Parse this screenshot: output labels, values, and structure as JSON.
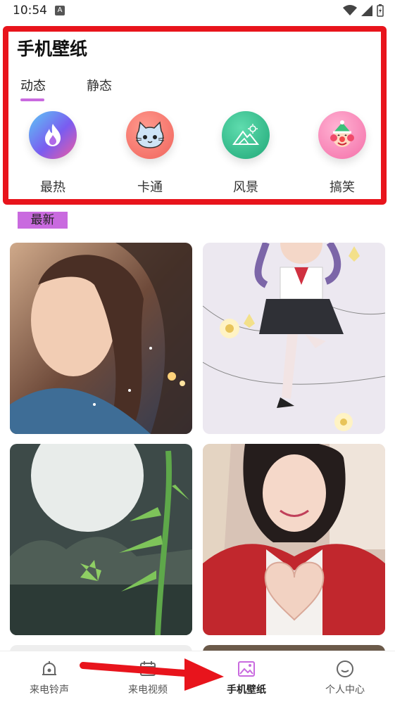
{
  "status_bar": {
    "time": "10:54",
    "notif_icon": "A"
  },
  "header": {
    "title": "手机壁纸"
  },
  "tabs": [
    {
      "label": "动态",
      "active": true
    },
    {
      "label": "静态",
      "active": false
    }
  ],
  "categories": [
    {
      "label": "最热",
      "icon": "flame-icon",
      "color": "#5b6cf0"
    },
    {
      "label": "卡通",
      "icon": "cat-face-icon",
      "color": "#f0706a"
    },
    {
      "label": "风景",
      "icon": "landscape-icon",
      "color": "#2fbf8c"
    },
    {
      "label": "搞笑",
      "icon": "clown-icon",
      "color": "#f483b8"
    }
  ],
  "section": {
    "latest_label": "最新"
  },
  "bottom_nav": [
    {
      "label": "来电铃声",
      "icon": "bell-icon",
      "active": false
    },
    {
      "label": "来电视频",
      "icon": "calendar-video-icon",
      "active": false
    },
    {
      "label": "手机壁纸",
      "icon": "wallpaper-icon",
      "active": true
    },
    {
      "label": "个人中心",
      "icon": "smiley-icon",
      "active": false
    }
  ],
  "colors": {
    "accent": "#c96adf",
    "annotation_red": "#e8141c"
  }
}
